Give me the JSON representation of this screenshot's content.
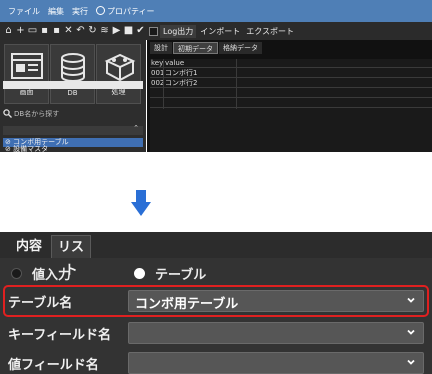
{
  "menubar": {
    "items": [
      "ファイル",
      "編集",
      "実行",
      "プロパティー"
    ]
  },
  "toolbar": {
    "log_label": "Log出力",
    "import_label": "インポート",
    "export_label": "エクスポート"
  },
  "left_pane": {
    "tiles": [
      "画面",
      "DB",
      "処理"
    ],
    "search_placeholder": "DB名から探す",
    "tree_items": [
      "コンボ用テーブル",
      "設備マスタ"
    ]
  },
  "right_pane": {
    "tabs": [
      "設計",
      "初期データ",
      "格納データ"
    ],
    "grid_headers": [
      "key",
      "value"
    ],
    "grid_rows": [
      {
        "key": "001",
        "value": "コンボ行1"
      },
      {
        "key": "002",
        "value": "コンボ行2"
      }
    ]
  },
  "bottom_panel": {
    "tabs": [
      "内容",
      "リスト"
    ],
    "radio_manual": "値入力",
    "radio_table": "テーブル",
    "fields": [
      {
        "label": "テーブル名",
        "value": "コンボ用テーブル"
      },
      {
        "label": "キーフィールド名",
        "value": ""
      },
      {
        "label": "値フィールド名",
        "value": ""
      }
    ]
  },
  "colors": {
    "menubar": "#4f7fb6",
    "arrow": "#2a6fd6",
    "highlight": "#e02020",
    "selected_row": "#3f6fb3"
  }
}
